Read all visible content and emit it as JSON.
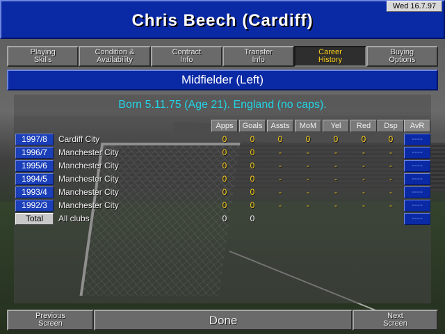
{
  "date": "Wed 16.7.97",
  "title": "Chris Beech (Cardiff)",
  "tabs": [
    {
      "label": "Playing\nSkills",
      "active": false
    },
    {
      "label": "Condition &\nAvailability",
      "active": false
    },
    {
      "label": "Contract\nInfo",
      "active": false
    },
    {
      "label": "Transfer\nInfo",
      "active": false
    },
    {
      "label": "Career\nHistory",
      "active": true
    },
    {
      "label": "Buying\nOptions",
      "active": false
    }
  ],
  "position": "Midfielder (Left)",
  "born": "Born 5.11.75 (Age 21). England (no caps).",
  "table": {
    "headers": [
      "Apps",
      "Goals",
      "Assts",
      "MoM",
      "Yel",
      "Red",
      "Dsp",
      "AvR"
    ],
    "rows": [
      {
        "season": "1997/8",
        "club": "Cardiff City",
        "values": [
          "0",
          "0",
          "0",
          "0",
          "0",
          "0",
          "0"
        ],
        "avr": "----"
      },
      {
        "season": "1996/7",
        "club": "Manchester City",
        "values": [
          "0",
          "0",
          "-",
          "-",
          "-",
          "-",
          "-"
        ],
        "avr": "----"
      },
      {
        "season": "1995/6",
        "club": "Manchester City",
        "values": [
          "0",
          "0",
          "-",
          "-",
          "-",
          "-",
          "-"
        ],
        "avr": "----"
      },
      {
        "season": "1994/5",
        "club": "Manchester City",
        "values": [
          "0",
          "0",
          "-",
          "-",
          "-",
          "-",
          "-"
        ],
        "avr": "----"
      },
      {
        "season": "1993/4",
        "club": "Manchester City",
        "values": [
          "0",
          "0",
          "-",
          "-",
          "-",
          "-",
          "-"
        ],
        "avr": "----"
      },
      {
        "season": "1992/3",
        "club": "Manchester City",
        "values": [
          "0",
          "0",
          "-",
          "-",
          "-",
          "-",
          "-"
        ],
        "avr": "----"
      }
    ],
    "total": {
      "label": "Total",
      "club": "All clubs",
      "values": [
        "0",
        "0"
      ],
      "avr": "----"
    }
  },
  "bottom": {
    "previous": "Previous\nScreen",
    "done": "Done",
    "next": "Next\nScreen"
  },
  "colors": {
    "title_blue": "#0a2aa5",
    "value_yellow": "#ffd21a",
    "born_cyan": "#22d4e6"
  }
}
